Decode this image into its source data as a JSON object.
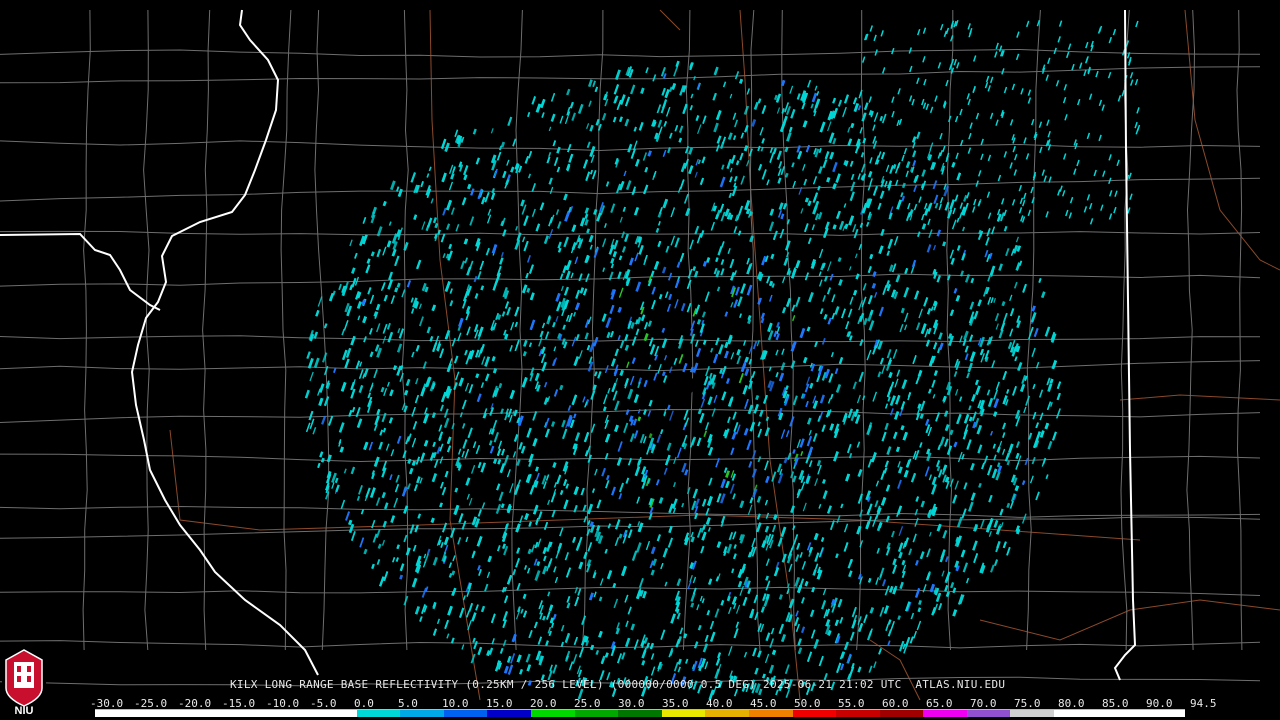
{
  "product": {
    "caption": "KILX LONG RANGE BASE REFLECTIVITY (0.25KM / 256 LEVEL) (000000/0000 0.5 DEG) 2025-06-21 21:02 UTC  ATLAS.NIU.EDU"
  },
  "logo": {
    "text": "NIU",
    "color": "#c8102e"
  },
  "colorbar": {
    "labels": [
      "-30.0",
      "-25.0",
      "-20.0",
      "-15.0",
      "-10.0",
      "-5.0",
      "0.0",
      "5.0",
      "10.0",
      "15.0",
      "20.0",
      "25.0",
      "30.0",
      "35.0",
      "40.0",
      "45.0",
      "50.0",
      "55.0",
      "60.0",
      "65.0",
      "70.0",
      "75.0",
      "80.0",
      "85.0",
      "90.0",
      "94.5"
    ],
    "colors": [
      "#ffffff",
      "#ffffff",
      "#ffffff",
      "#ffffff",
      "#ffffff",
      "#ffffff",
      "#00d8d8",
      "#00a8e8",
      "#0060f0",
      "#0000c8",
      "#00d800",
      "#00a800",
      "#007800",
      "#e8e800",
      "#e8b000",
      "#f08000",
      "#f00000",
      "#c80000",
      "#a00000",
      "#f000f0",
      "#9050d0",
      "#d0d0d0",
      "#ffffff",
      "#ffffff",
      "#ffffff"
    ]
  },
  "colors": {
    "background": "#000000",
    "county_lines": "#6e6e6e",
    "state_lines": "#ffffff",
    "roads": "#8b4a2b",
    "echo_light": "#00d8d8",
    "echo_blue": "#1e78ff",
    "echo_green": "#28c828"
  },
  "radar": {
    "site": "KILX"
  }
}
